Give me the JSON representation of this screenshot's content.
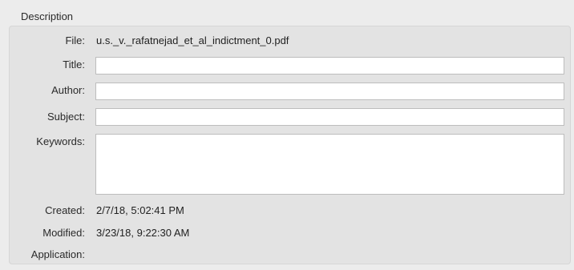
{
  "section": {
    "title": "Description"
  },
  "fields": {
    "file_label": "File:",
    "file_value": "u.s._v._rafatnejad_et_al_indictment_0.pdf",
    "title_label": "Title:",
    "title_value": "",
    "author_label": "Author:",
    "author_value": "",
    "subject_label": "Subject:",
    "subject_value": "",
    "keywords_label": "Keywords:",
    "keywords_value": "",
    "created_label": "Created:",
    "created_value": "2/7/18, 5:02:41 PM",
    "modified_label": "Modified:",
    "modified_value": "3/23/18, 9:22:30 AM",
    "application_label": "Application:",
    "application_value": ""
  },
  "colors": {
    "window_background": "#ececec",
    "group_background": "#e3e3e3",
    "field_background": "#ffffff",
    "field_border": "#bdbdbd"
  }
}
